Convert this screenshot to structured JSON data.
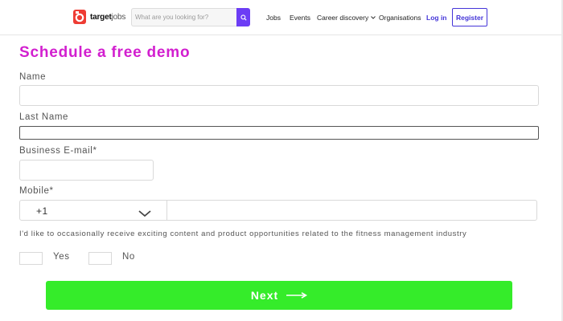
{
  "header": {
    "logo_text": "target",
    "logo_suffix": "jobs",
    "search_placeholder": "What are you looking for?",
    "nav": {
      "jobs": "Jobs",
      "events": "Events",
      "career_discovery": "Career discovery",
      "organisations": "Organisations",
      "login": "Log in",
      "register": "Register"
    },
    "colors": {
      "accent": "#4435d8",
      "search_button": "#6c3df5",
      "logo": "#ee3c34"
    }
  },
  "form": {
    "title": "Schedule a free demo",
    "title_color": "#d21fcf",
    "fields": {
      "name_label": "Name",
      "name_value": "",
      "last_name_label": "Last Name",
      "last_name_value": "",
      "email_label": "Business E-mail*",
      "email_value": "",
      "mobile_label": "Mobile*",
      "country_code": "+1",
      "mobile_value": ""
    },
    "consent_text": "I'd like to occasionally receive exciting content and product opportunities related to the fitness management industry",
    "options": {
      "yes": "Yes",
      "no": "No"
    },
    "next_button": "Next",
    "next_color": "#35ec2a"
  }
}
